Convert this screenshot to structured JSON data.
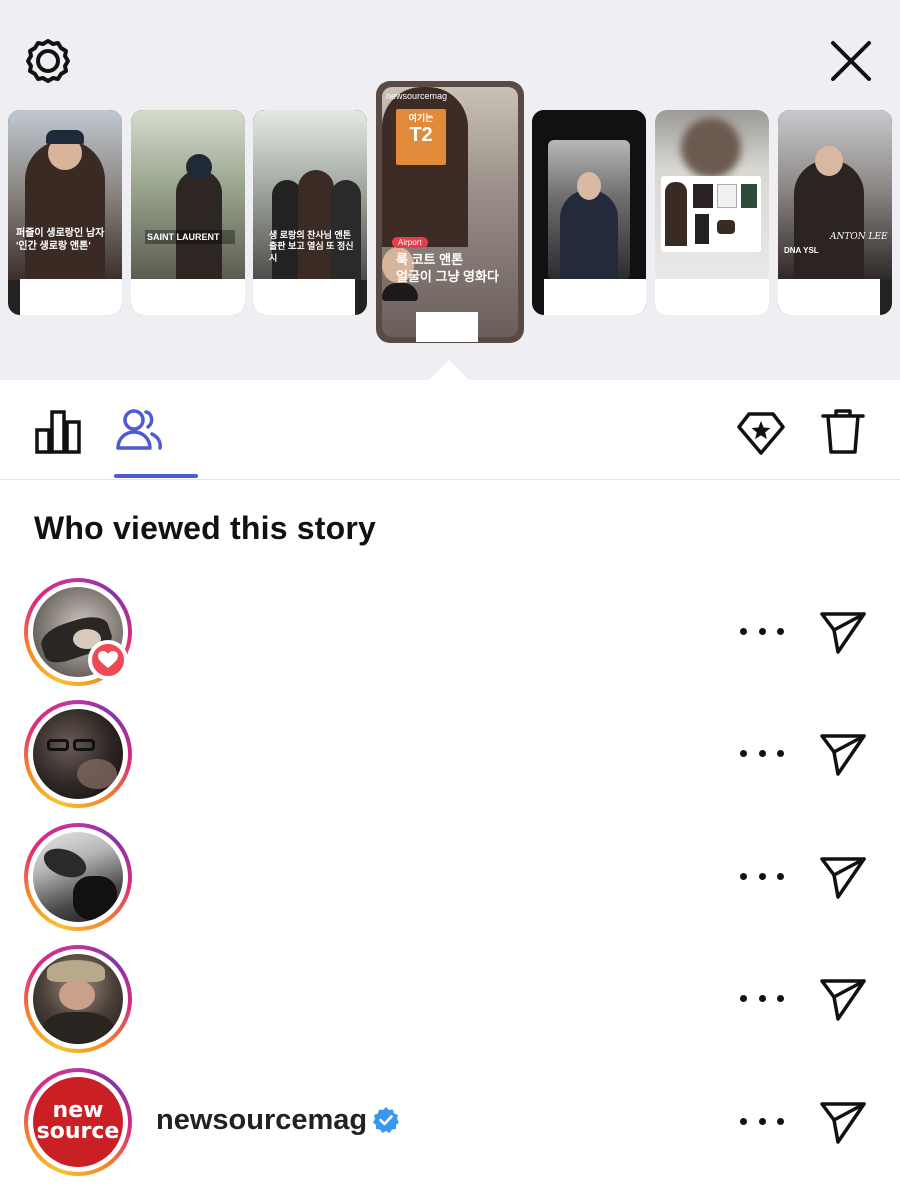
{
  "header": {
    "settings_icon": "gear-icon",
    "close_icon": "close-icon"
  },
  "story_strip": {
    "thumbnails": [
      {
        "caption_line1": "퍼즐이 생로랑인 남자",
        "caption_line2": "'인간 생로랑 앤톤'"
      },
      {
        "caption_line1": "SAINT LAURENT",
        "caption_line2": ""
      },
      {
        "caption_line1": "생 로랑의 찬사님 앤톤",
        "caption_line2": "출판 보고 열심 또 정신시"
      },
      {
        "caption_line1": "newsourcemag",
        "caption_line2": "룩 코트 앤톤",
        "caption_line3": "얼굴이 그냥 영화다",
        "tag": "Airport",
        "sign": "T2",
        "sign_small": "여기는"
      },
      {
        "caption_line1": "",
        "caption_line2": ""
      },
      {
        "caption_line1": "",
        "caption_line2": ""
      },
      {
        "caption_line1": "ANTON LEE",
        "caption_line2": "DNA YSL"
      }
    ],
    "selected_index": 3
  },
  "toolbar": {
    "tabs": [
      {
        "name": "insights",
        "icon": "bar-chart-icon",
        "active": false
      },
      {
        "name": "viewers",
        "icon": "people-icon",
        "active": true
      }
    ],
    "actions": [
      {
        "name": "highlight",
        "icon": "diamond-star-icon"
      },
      {
        "name": "delete",
        "icon": "trash-icon"
      }
    ],
    "accent": "#4f5bd5"
  },
  "viewers": {
    "heading": "Who viewed this story",
    "list": [
      {
        "username": "",
        "liked": true,
        "verified": false
      },
      {
        "username": "",
        "liked": false,
        "verified": false
      },
      {
        "username": "",
        "liked": false,
        "verified": false
      },
      {
        "username": "",
        "liked": false,
        "verified": false
      },
      {
        "username": "newsourcemag",
        "liked": false,
        "verified": true,
        "avatar_text_1": "new",
        "avatar_text_2": "source"
      }
    ]
  }
}
